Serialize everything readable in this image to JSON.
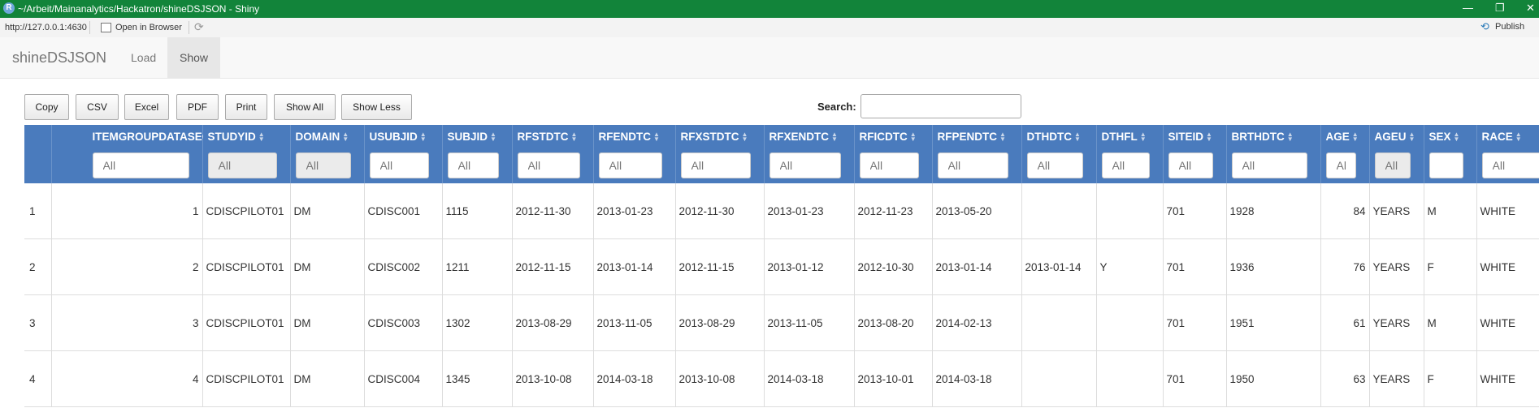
{
  "window": {
    "title": "~/Arbeit/Mainanalytics/Hackatron/shineDSJSON - Shiny",
    "app_icon": "R"
  },
  "toolbar": {
    "url": "http://127.0.0.1:4630",
    "open_in_browser": "Open in Browser",
    "publish": "Publish"
  },
  "navbar": {
    "brand": "shineDSJSON",
    "tabs": [
      {
        "label": "Load"
      },
      {
        "label": "Show"
      }
    ]
  },
  "buttons": {
    "copy": "Copy",
    "csv": "CSV",
    "excel": "Excel",
    "pdf": "PDF",
    "print": "Print",
    "show_all": "Show All",
    "show_less": "Show Less"
  },
  "search": {
    "label": "Search:"
  },
  "table": {
    "columns": [
      "",
      "ITEMGROUPDATASEQ",
      "STUDYID",
      "DOMAIN",
      "USUBJID",
      "SUBJID",
      "RFSTDTC",
      "RFENDTC",
      "RFXSTDTC",
      "RFXENDTC",
      "RFICDTC",
      "RFPENDTC",
      "DTHDTC",
      "DTHFL",
      "SITEID",
      "BRTHDTC",
      "AGE",
      "AGEU",
      "SEX",
      "RACE"
    ],
    "filter_placeholder": "All",
    "rows": [
      [
        "1",
        "1",
        "CDISCPILOT01",
        "DM",
        "CDISC001",
        "1115",
        "2012-11-30",
        "2013-01-23",
        "2012-11-30",
        "2013-01-23",
        "2012-11-23",
        "2013-05-20",
        "",
        "",
        "701",
        "1928",
        "84",
        "YEARS",
        "M",
        "WHITE"
      ],
      [
        "2",
        "2",
        "CDISCPILOT01",
        "DM",
        "CDISC002",
        "1211",
        "2012-11-15",
        "2013-01-14",
        "2012-11-15",
        "2013-01-12",
        "2012-10-30",
        "2013-01-14",
        "2013-01-14",
        "Y",
        "701",
        "1936",
        "76",
        "YEARS",
        "F",
        "WHITE"
      ],
      [
        "3",
        "3",
        "CDISCPILOT01",
        "DM",
        "CDISC003",
        "1302",
        "2013-08-29",
        "2013-11-05",
        "2013-08-29",
        "2013-11-05",
        "2013-08-20",
        "2014-02-13",
        "",
        "",
        "701",
        "1951",
        "61",
        "YEARS",
        "M",
        "WHITE"
      ],
      [
        "4",
        "4",
        "CDISCPILOT01",
        "DM",
        "CDISC004",
        "1345",
        "2013-10-08",
        "2014-03-18",
        "2013-10-08",
        "2014-03-18",
        "2013-10-01",
        "2014-03-18",
        "",
        "",
        "701",
        "1950",
        "63",
        "YEARS",
        "F",
        "WHITE"
      ]
    ]
  },
  "colors": {
    "titlebar": "#12843a",
    "table_header": "#4a7bbd"
  }
}
